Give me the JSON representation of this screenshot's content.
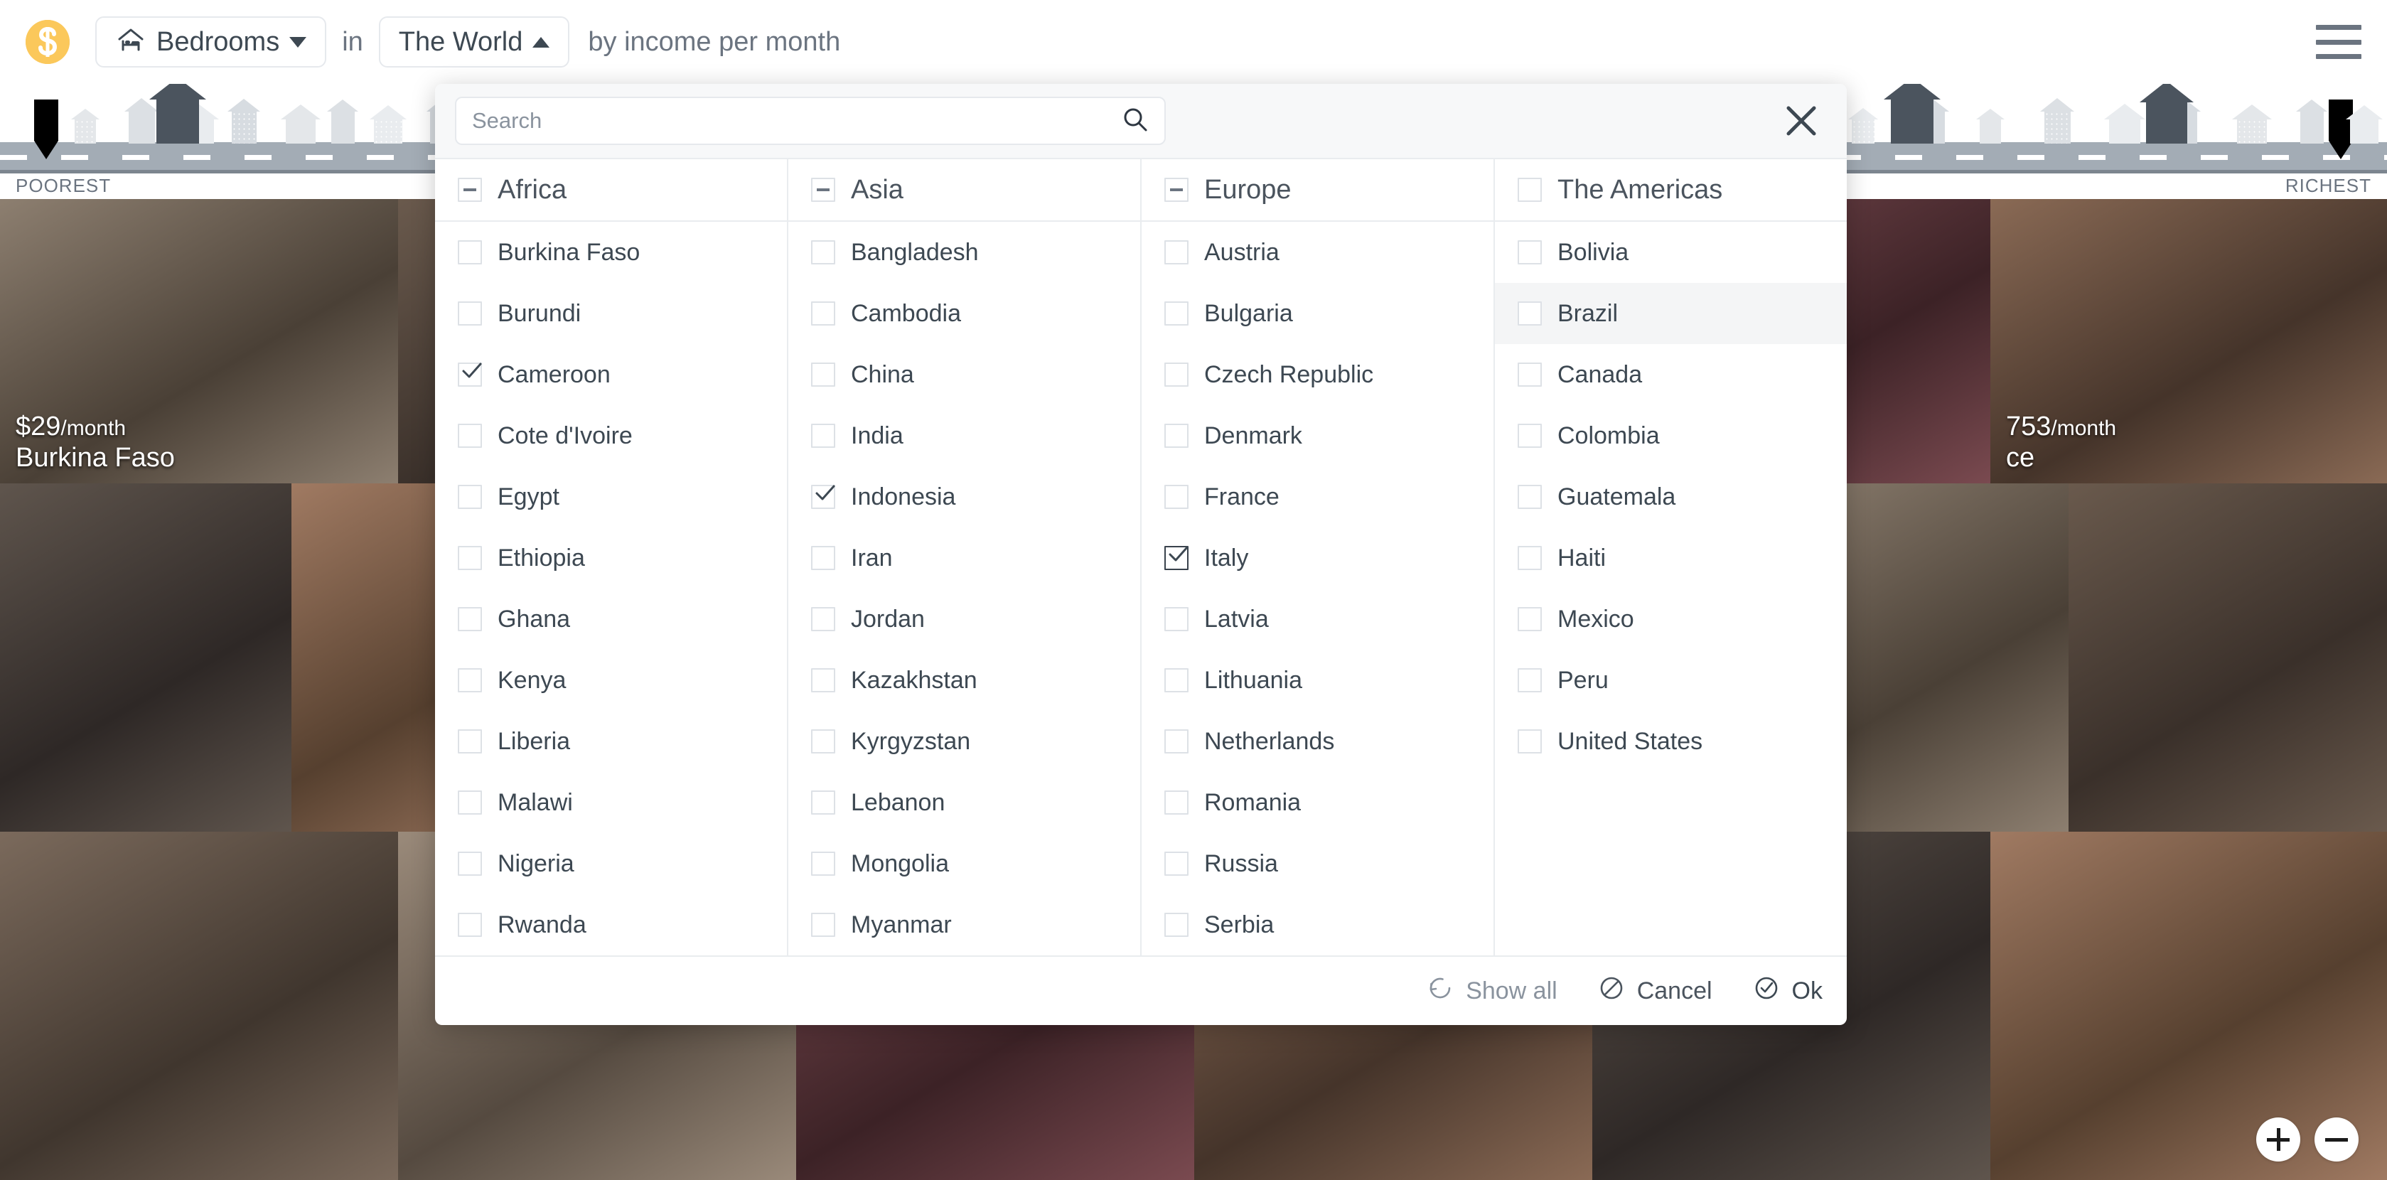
{
  "topbar": {
    "logo_icon": "dollar-coin-icon",
    "topic_label": "Bedrooms",
    "topic_icon": "bedroom-icon",
    "word_in": "in",
    "place_label": "The World",
    "by_text": "by income per month",
    "menu_icon": "hamburger-menu-icon"
  },
  "street": {
    "poorest_label": "POOREST",
    "richest_label": "RICHEST"
  },
  "dialog": {
    "search": {
      "placeholder": "Search",
      "value": "",
      "icon": "search-icon"
    },
    "close_icon": "close-icon",
    "columns": [
      {
        "title": "Africa",
        "state": "indeterminate",
        "items": [
          {
            "label": "Burkina Faso",
            "checked": false
          },
          {
            "label": "Burundi",
            "checked": false
          },
          {
            "label": "Cameroon",
            "checked": true
          },
          {
            "label": "Cote d'Ivoire",
            "checked": false
          },
          {
            "label": "Egypt",
            "checked": false
          },
          {
            "label": "Ethiopia",
            "checked": false
          },
          {
            "label": "Ghana",
            "checked": false
          },
          {
            "label": "Kenya",
            "checked": false
          },
          {
            "label": "Liberia",
            "checked": false
          },
          {
            "label": "Malawi",
            "checked": false
          },
          {
            "label": "Nigeria",
            "checked": false
          },
          {
            "label": "Rwanda",
            "checked": false
          }
        ]
      },
      {
        "title": "Asia",
        "state": "indeterminate",
        "items": [
          {
            "label": "Bangladesh",
            "checked": false
          },
          {
            "label": "Cambodia",
            "checked": false
          },
          {
            "label": "China",
            "checked": false
          },
          {
            "label": "India",
            "checked": false
          },
          {
            "label": "Indonesia",
            "checked": true
          },
          {
            "label": "Iran",
            "checked": false
          },
          {
            "label": "Jordan",
            "checked": false
          },
          {
            "label": "Kazakhstan",
            "checked": false
          },
          {
            "label": "Kyrgyzstan",
            "checked": false
          },
          {
            "label": "Lebanon",
            "checked": false
          },
          {
            "label": "Mongolia",
            "checked": false
          },
          {
            "label": "Myanmar",
            "checked": false
          }
        ]
      },
      {
        "title": "Europe",
        "state": "indeterminate",
        "items": [
          {
            "label": "Austria",
            "checked": false
          },
          {
            "label": "Bulgaria",
            "checked": false
          },
          {
            "label": "Czech Republic",
            "checked": false
          },
          {
            "label": "Denmark",
            "checked": false
          },
          {
            "label": "France",
            "checked": false
          },
          {
            "label": "Italy",
            "checked": true,
            "focused": true
          },
          {
            "label": "Latvia",
            "checked": false
          },
          {
            "label": "Lithuania",
            "checked": false
          },
          {
            "label": "Netherlands",
            "checked": false
          },
          {
            "label": "Romania",
            "checked": false
          },
          {
            "label": "Russia",
            "checked": false
          },
          {
            "label": "Serbia",
            "checked": false
          }
        ]
      },
      {
        "title": "The Americas",
        "state": "unchecked",
        "items": [
          {
            "label": "Bolivia",
            "checked": false
          },
          {
            "label": "Brazil",
            "checked": false,
            "hover": true
          },
          {
            "label": "Canada",
            "checked": false
          },
          {
            "label": "Colombia",
            "checked": false
          },
          {
            "label": "Guatemala",
            "checked": false
          },
          {
            "label": "Haiti",
            "checked": false
          },
          {
            "label": "Mexico",
            "checked": false
          },
          {
            "label": "Peru",
            "checked": false
          },
          {
            "label": "United States",
            "checked": false
          }
        ]
      }
    ],
    "footer": [
      {
        "label": "Show all",
        "icon": "reset-circle-icon",
        "style": "dim"
      },
      {
        "label": "Cancel",
        "icon": "circle-slash-icon",
        "style": "normal"
      },
      {
        "label": "Ok",
        "icon": "circle-check-icon",
        "style": "ok"
      }
    ]
  },
  "photos": [
    {
      "amount": "$29",
      "per": "/month",
      "country": "Burkina Faso",
      "color1": "#8d7f70",
      "color2": "#5b4f45"
    },
    {
      "amount": "753",
      "per": "/month",
      "country": "ce",
      "color1": "#8d5a66",
      "color2": "#55333d"
    }
  ],
  "zoom_controls": {
    "zoom_in_icon": "plus-icon",
    "zoom_out_icon": "minus-icon"
  },
  "colors": {
    "accent_yellow": "#FBC85B",
    "text_dark": "#3D4852",
    "text_muted": "#6B7480",
    "border": "#E6E9ED",
    "hover_row": "#F4F5F6"
  }
}
